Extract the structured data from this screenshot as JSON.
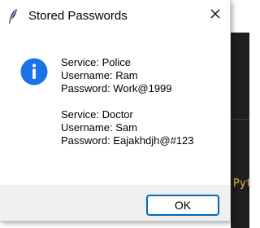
{
  "window": {
    "title": "Stored Passwords",
    "app_icon": "feather-icon",
    "close_icon": "close-icon"
  },
  "message": {
    "icon": "info-icon",
    "accent_color": "#1a73e8",
    "entries": [
      {
        "service": "Service: Police",
        "username": "Username: Ram",
        "password": "Password: Work@1999"
      },
      {
        "service": "Service: Doctor",
        "username": "Username: Sam",
        "password": "Password: Eajakhdjh@#123"
      }
    ]
  },
  "buttons": {
    "ok_label": "OK"
  },
  "background": {
    "snippet_text": "Pyt"
  }
}
